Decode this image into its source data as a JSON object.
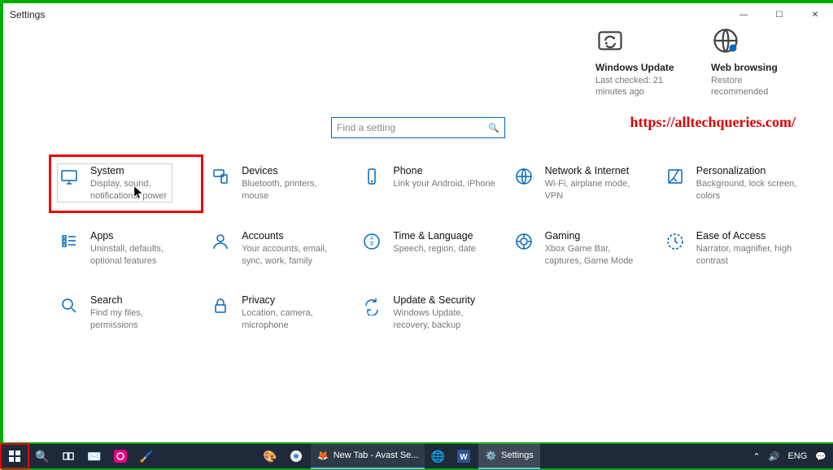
{
  "window": {
    "title": "Settings"
  },
  "win_controls": {
    "min": "—",
    "max": "☐",
    "close": "✕"
  },
  "status": {
    "update": {
      "title": "Windows Update",
      "sub": "Last checked: 21 minutes ago"
    },
    "web": {
      "title": "Web browsing",
      "sub": "Restore recommended"
    }
  },
  "watermark": "https://alltechqueries.com/",
  "search": {
    "placeholder": "Find a setting"
  },
  "tiles": [
    {
      "id": "system",
      "title": "System",
      "desc": "Display, sound, notifications, power"
    },
    {
      "id": "devices",
      "title": "Devices",
      "desc": "Bluetooth, printers, mouse"
    },
    {
      "id": "phone",
      "title": "Phone",
      "desc": "Link your Android, iPhone"
    },
    {
      "id": "network",
      "title": "Network & Internet",
      "desc": "Wi-Fi, airplane mode, VPN"
    },
    {
      "id": "personalization",
      "title": "Personalization",
      "desc": "Background, lock screen, colors"
    },
    {
      "id": "apps",
      "title": "Apps",
      "desc": "Uninstall, defaults, optional features"
    },
    {
      "id": "accounts",
      "title": "Accounts",
      "desc": "Your accounts, email, sync, work, family"
    },
    {
      "id": "time",
      "title": "Time & Language",
      "desc": "Speech, region, date"
    },
    {
      "id": "gaming",
      "title": "Gaming",
      "desc": "Xbox Game Bar, captures, Game Mode"
    },
    {
      "id": "ease",
      "title": "Ease of Access",
      "desc": "Narrator, magnifier, high contrast"
    },
    {
      "id": "search",
      "title": "Search",
      "desc": "Find my files, permissions"
    },
    {
      "id": "privacy",
      "title": "Privacy",
      "desc": "Location, camera, microphone"
    },
    {
      "id": "update",
      "title": "Update & Security",
      "desc": "Windows Update, recovery, backup"
    }
  ],
  "taskbar": {
    "running": [
      {
        "id": "firefox",
        "label": "New Tab - Avast Se..."
      },
      {
        "id": "settings",
        "label": "Settings"
      }
    ],
    "tray": {
      "lang": "ENG",
      "chevron": "⌃",
      "wifi": "⇅",
      "sound": "🔊"
    }
  }
}
